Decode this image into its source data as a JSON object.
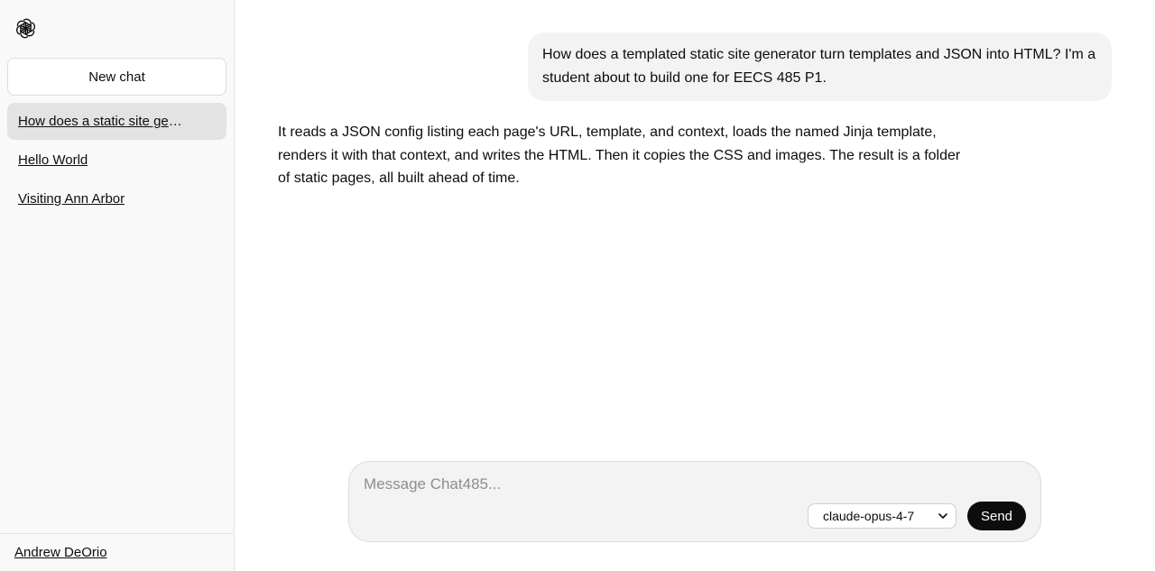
{
  "sidebar": {
    "logo_icon": "openai-logo-icon",
    "new_chat_label": "New chat",
    "items": [
      {
        "label": "How does a static site generator work?",
        "display": "How does a static site gen...",
        "active": true
      },
      {
        "label": "Hello World",
        "display": "Hello World",
        "active": false
      },
      {
        "label": "Visiting Ann Arbor",
        "display": "Visiting Ann Arbor",
        "active": false
      }
    ],
    "user_name": "Andrew DeOrio"
  },
  "conversation": {
    "user_message": "How does a templated static site generator turn templates and JSON into HTML? I'm a student about to build one for EECS 485 P1.",
    "assistant_message": "It reads a JSON config listing each page's URL, template, and context, loads the named Jinja template, renders it with that context, and writes the HTML. Then it copies the CSS and images. The result is a folder of static pages, all built ahead of time."
  },
  "composer": {
    "placeholder": "Message Chat485...",
    "value": "",
    "model_selected": "claude-opus-4-7",
    "send_label": "Send"
  },
  "colors": {
    "sidebar_bg": "#f9f9f9",
    "active_item_bg": "#e3e3e3",
    "bubble_bg": "#f3f3f3",
    "send_bg": "#0d0d0d"
  }
}
